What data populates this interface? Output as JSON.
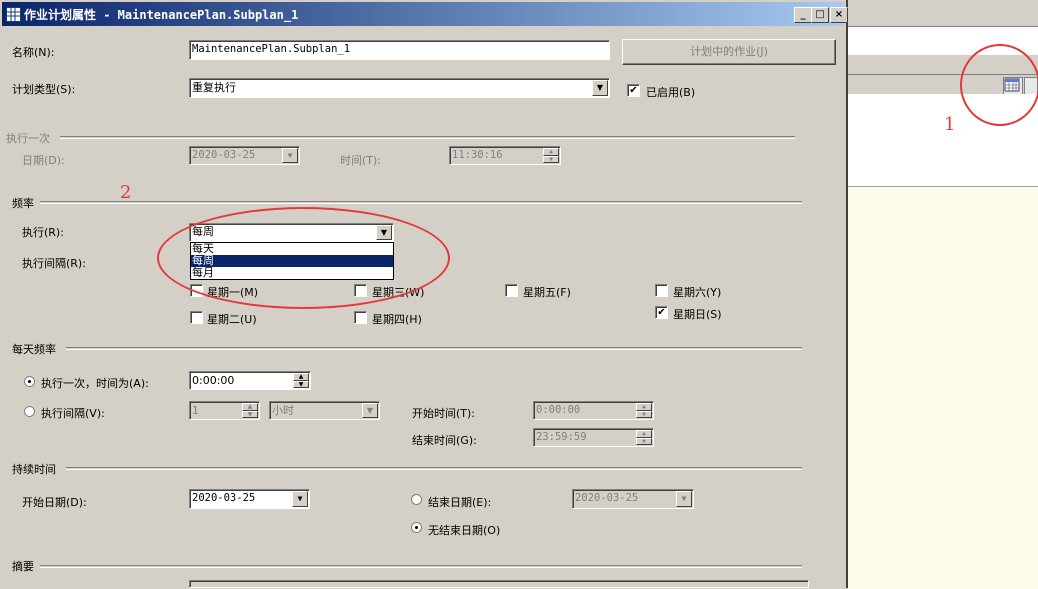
{
  "window": {
    "title": "作业计划属性 - MaintenancePlan.Subplan_1",
    "minimize": "_",
    "maximize": "□",
    "close": "×"
  },
  "general": {
    "name_label": "名称(N):",
    "name_value": "MaintenancePlan.Subplan_1",
    "jobs_button": "计划中的作业(J)",
    "schedule_type_label": "计划类型(S):",
    "schedule_type_value": "重复执行",
    "enabled_label": "已启用(B)",
    "enabled_checked": true
  },
  "one_time": {
    "section": "执行一次",
    "date_label": "日期(D):",
    "date_value": "2020-03-25",
    "time_label": "时间(T):",
    "time_value": "11:30:16"
  },
  "frequency": {
    "section": "频率",
    "occurs_label": "执行(R):",
    "occurs_value": "每周",
    "options": [
      "每天",
      "每周",
      "每月"
    ],
    "selected_option": 1,
    "recur_label": "执行间隔(R):",
    "days": [
      {
        "label": "星期一(M)",
        "checked": false
      },
      {
        "label": "星期三(W)",
        "checked": false
      },
      {
        "label": "星期五(F)",
        "checked": false
      },
      {
        "label": "星期六(Y)",
        "checked": false
      },
      {
        "label": "星期二(U)",
        "checked": false
      },
      {
        "label": "星期四(H)",
        "checked": false
      },
      {
        "label": "星期日(S)",
        "checked": true
      }
    ]
  },
  "daily": {
    "section": "每天频率",
    "once_label": "执行一次，时间为(A):",
    "once_value": "0:00:00",
    "every_label": "执行间隔(V):",
    "every_value": "1",
    "every_unit": "小时",
    "start_label": "开始时间(T):",
    "start_value": "0:00:00",
    "end_label": "结束时间(G):",
    "end_value": "23:59:59"
  },
  "duration": {
    "section": "持续时间",
    "start_date_label": "开始日期(D):",
    "start_date_value": "2020-03-25",
    "end_date_label": "结束日期(E):",
    "end_date_value": "2020-03-25",
    "no_end_label": "无结束日期(O)"
  },
  "summary": {
    "section": "摘要"
  },
  "annotations": {
    "marker1": "1",
    "marker2": "2",
    "color": "#e23a3a"
  },
  "colors": {
    "titlebar": "#0a246a",
    "face": "#d4d0c8",
    "selection": "#0a246a"
  }
}
